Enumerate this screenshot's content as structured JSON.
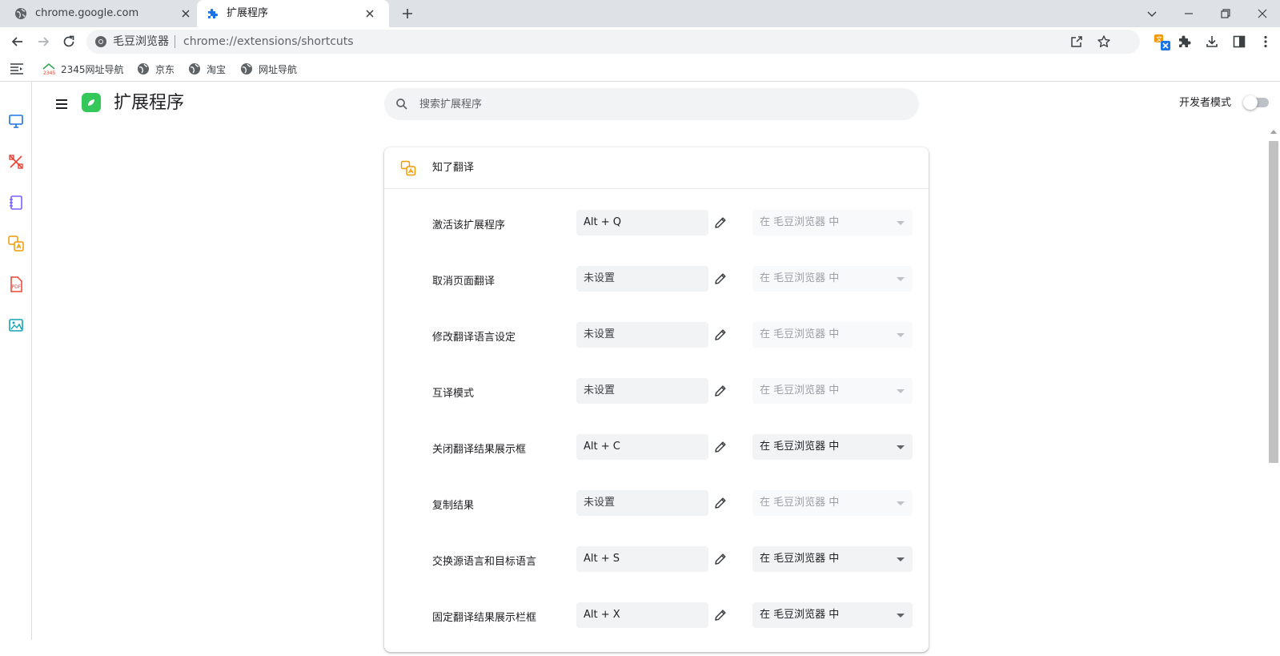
{
  "browser": {
    "tabs": [
      {
        "title": "chrome.google.com",
        "active": false
      },
      {
        "title": "扩展程序",
        "active": true
      }
    ],
    "omnibox": {
      "site_name": "毛豆浏览器",
      "url": "chrome://extensions/shortcuts"
    },
    "bookmarks": [
      {
        "label": "2345网址导航"
      },
      {
        "label": "京东"
      },
      {
        "label": "淘宝"
      },
      {
        "label": "网址导航"
      }
    ]
  },
  "side_panel": {
    "icons": [
      "monitor-icon",
      "design-tools-icon",
      "notebook-icon",
      "translate-icon",
      "pdf-icon",
      "image-icon"
    ]
  },
  "header": {
    "title": "扩展程序",
    "search_placeholder": "搜索扩展程序",
    "dev_mode_label": "开发者模式",
    "dev_mode_on": false
  },
  "extension": {
    "name": "知了翻译",
    "shortcuts": [
      {
        "label": "激活该扩展程序",
        "key": "Alt + Q",
        "scope": "在 毛豆浏览器 中",
        "scope_enabled": false
      },
      {
        "label": "取消页面翻译",
        "key": "未设置",
        "scope": "在 毛豆浏览器 中",
        "scope_enabled": false
      },
      {
        "label": "修改翻译语言设定",
        "key": "未设置",
        "scope": "在 毛豆浏览器 中",
        "scope_enabled": false
      },
      {
        "label": "互译模式",
        "key": "未设置",
        "scope": "在 毛豆浏览器 中",
        "scope_enabled": false
      },
      {
        "label": "关闭翻译结果展示框",
        "key": "Alt + C",
        "scope": "在 毛豆浏览器 中",
        "scope_enabled": true
      },
      {
        "label": "复制结果",
        "key": "未设置",
        "scope": "在 毛豆浏览器 中",
        "scope_enabled": false
      },
      {
        "label": "交换源语言和目标语言",
        "key": "Alt + S",
        "scope": "在 毛豆浏览器 中",
        "scope_enabled": true
      },
      {
        "label": "固定翻译结果展示栏框",
        "key": "Alt + X",
        "scope": "在 毛豆浏览器 中",
        "scope_enabled": true
      }
    ]
  },
  "colors": {
    "accent": "#1a73e8",
    "logo_green": "#34c759",
    "translate_orange": "#f29900"
  }
}
